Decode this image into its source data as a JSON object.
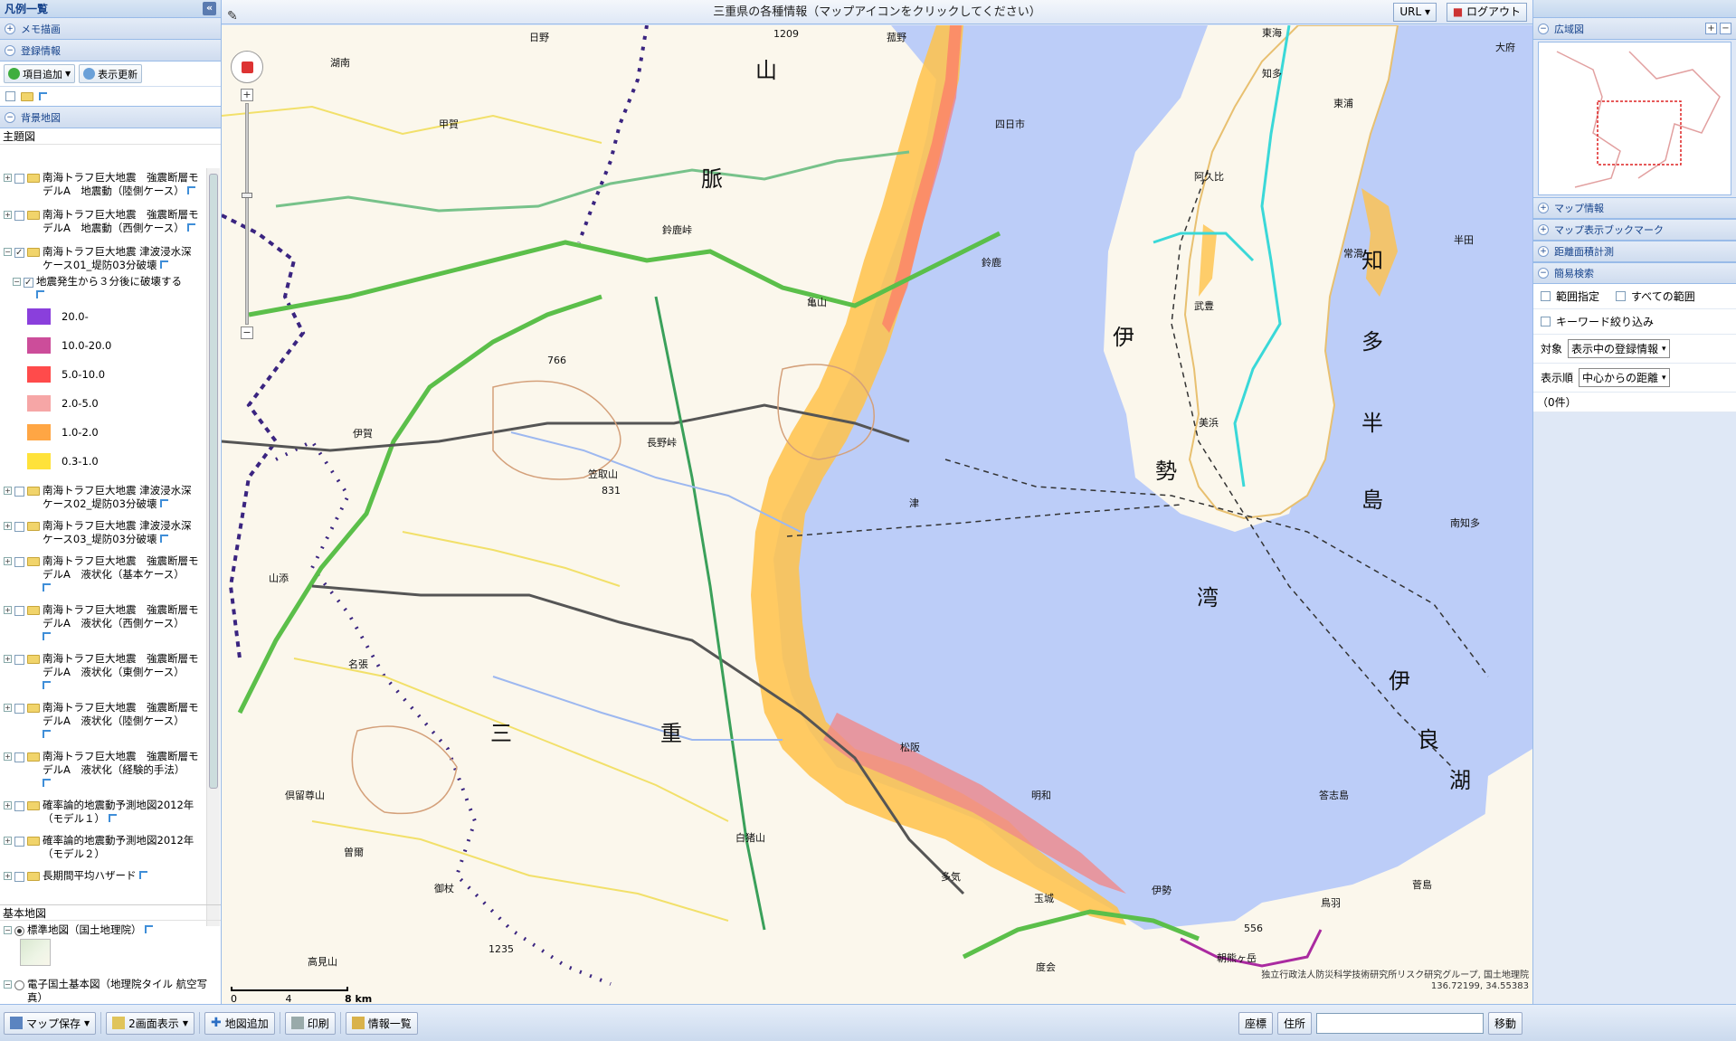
{
  "left_panel": {
    "title": "凡例一覧",
    "memo_section": "メモ描画",
    "registered_section": "登録情報",
    "add_item_label": "項目追加",
    "refresh_label": "表示更新",
    "background_section": "背景地図",
    "theme_group": "主題図",
    "layers": [
      {
        "label": "南海トラフ巨大地震　強震断層モデルA　地震動（陸側ケース）",
        "checked": false
      },
      {
        "label": "南海トラフ巨大地震　強震断層モデルA　地震動（西側ケース）",
        "checked": false
      },
      {
        "label": "南海トラフ巨大地震 津波浸水深 ケース01_堤防03分破壊",
        "checked": true
      }
    ],
    "sublayer": "地震発生から３分後に破壊する",
    "legend": [
      {
        "label": "20.0-",
        "color": "#8a3fdc"
      },
      {
        "label": "10.0-20.0",
        "color": "#cc4d9a"
      },
      {
        "label": "5.0-10.0",
        "color": "#ff4b4b"
      },
      {
        "label": "2.0-5.0",
        "color": "#f6a6a6"
      },
      {
        "label": "1.0-2.0",
        "color": "#ffa644"
      },
      {
        "label": "0.3-1.0",
        "color": "#ffe23a"
      }
    ],
    "layers_after": [
      {
        "label": "南海トラフ巨大地震 津波浸水深 ケース02_堤防03分破壊"
      },
      {
        "label": "南海トラフ巨大地震 津波浸水深 ケース03_堤防03分破壊"
      },
      {
        "label": "南海トラフ巨大地震　強震断層モデルA　液状化（基本ケース）"
      },
      {
        "label": "南海トラフ巨大地震　強震断層モデルA　液状化（西側ケース）"
      },
      {
        "label": "南海トラフ巨大地震　強震断層モデルA　液状化（東側ケース）"
      },
      {
        "label": "南海トラフ巨大地震　強震断層モデルA　液状化（陸側ケース）"
      },
      {
        "label": "南海トラフ巨大地震　強震断層モデルA　液状化（経験的手法）"
      },
      {
        "label": "確率論的地震動予測地図2012年（モデル１）"
      },
      {
        "label": "確率論的地震動予測地図2012年（モデル２）"
      },
      {
        "label": "長期間平均ハザード"
      }
    ],
    "base_group": "基本地図",
    "base_layers": [
      {
        "label": "標準地図（国土地理院）"
      },
      {
        "label": "電子国土基本図（地理院タイル 航空写真）"
      }
    ]
  },
  "map": {
    "title": "三重県の各種情報（マップアイコンをクリックしてください）",
    "url_button": "URL",
    "logout_button": "ログアウト",
    "labels": {
      "hino": "日野",
      "komono": "菰野",
      "yokkaichi": "四日市",
      "suzuka": "鈴鹿",
      "kameyama": "亀山",
      "koka": "甲賀",
      "konan": "湖南",
      "iga": "伊賀",
      "nabari": "名張",
      "tsu": "津",
      "matsusaka": "松阪",
      "meiwa": "明和",
      "taki": "多気",
      "tamaki": "玉城",
      "ise": "伊勢",
      "toba": "鳥羽",
      "watarai": "度会",
      "soni": "曽爾",
      "mitsue": "御杖",
      "yamazoe": "山添",
      "chita": "知多",
      "tokai": "東海",
      "agui": "阿久比",
      "handa": "半田",
      "tokoname": "常滑",
      "taketoyo": "武豊",
      "mihama": "美浜",
      "minamichita": "南知多",
      "tobiura": "東浦",
      "obu": "大府",
      "suzuka_pass": "鈴鹿峠",
      "nagano_pass": "長野峠",
      "kasatori": "笠取山",
      "shiraino": "白猪山",
      "kuzurao": "倶留尊山",
      "takami": "高見山",
      "asakuma": "朝熊ヶ岳",
      "shijimi": "答志島",
      "suga": "菅島",
      "elev766": "766",
      "elev831": "831",
      "elev1235": "1235",
      "elev556": "556",
      "elev1209": "1209",
      "ise_wan_1": "伊",
      "ise_wan_2": "勢",
      "ise_wan_3": "湾",
      "mie_1": "三",
      "mie_2": "重",
      "chita_1": "知",
      "chita_2": "多",
      "chita_3": "半",
      "chita_4": "島",
      "irago_1": "伊",
      "irago_2": "良",
      "irago_3": "湖",
      "sanmyaku_1": "山",
      "sanmyaku_2": "脈"
    },
    "scale_labels": [
      "0",
      "4",
      "8 km"
    ],
    "attribution": "独立行政法人防災科学技術研究所リスク研究グループ, 国土地理院",
    "coords": "136.72199, 34.55383"
  },
  "right_panel": {
    "overview_section": "広域図",
    "map_info": "マップ情報",
    "bookmark": "マップ表示ブックマーク",
    "measure": "距離面積計測",
    "simple_search": "簡易検索",
    "range_label": "範囲指定",
    "all_range_label": "すべての範囲",
    "keyword_label": "キーワード絞り込み",
    "target_label": "対象",
    "target_value": "表示中の登録情報",
    "order_label": "表示順",
    "order_value": "中心からの距離",
    "count": "（0件）"
  },
  "bottom_bar": {
    "save_map": "マップ保存",
    "dual_view": "2画面表示",
    "add_map": "地図追加",
    "print": "印刷",
    "info_list": "情報一覧",
    "coord_label": "座標",
    "address_label": "住所",
    "move_label": "移動"
  }
}
